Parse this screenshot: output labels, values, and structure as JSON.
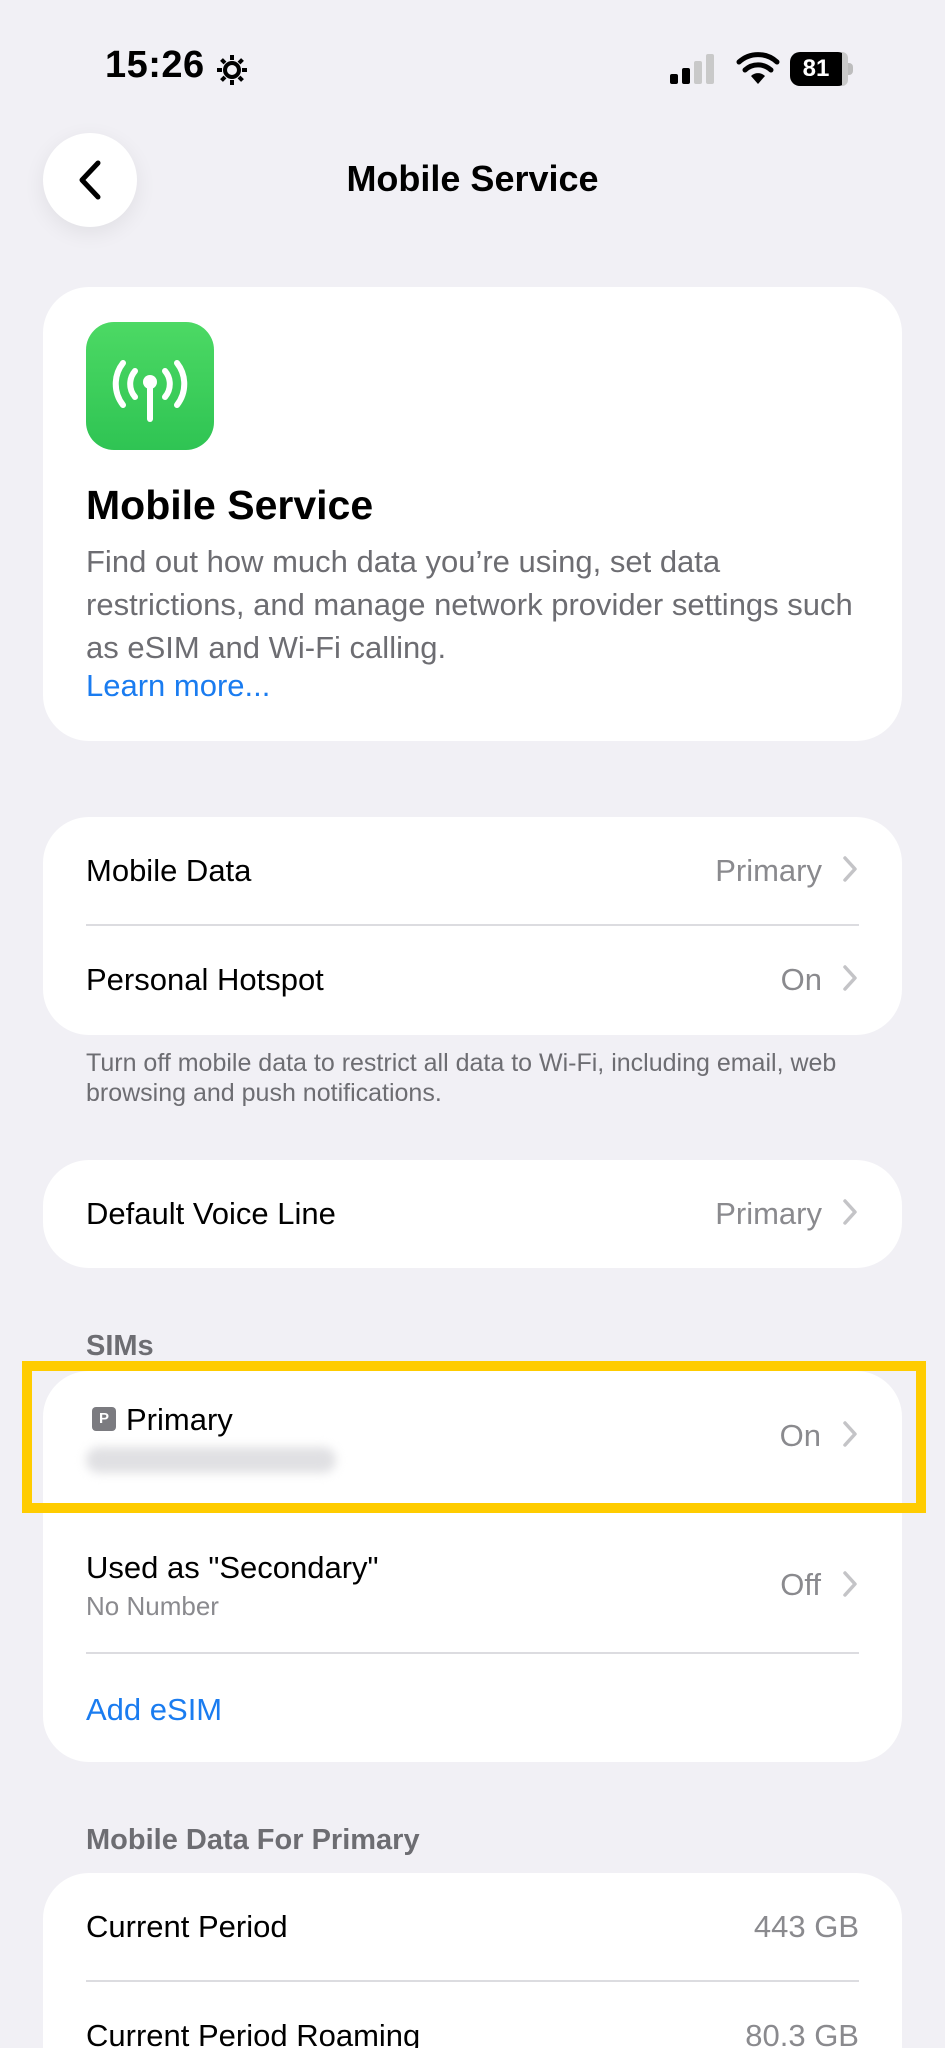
{
  "status_bar": {
    "time": "15:26",
    "battery": "81"
  },
  "nav": {
    "title": "Mobile Service"
  },
  "hero": {
    "title": "Mobile Service",
    "description": "Find out how much data you’re using, set data restrictions, and manage network provider settings such as eSIM and Wi-Fi calling.",
    "learn_more": "Learn more..."
  },
  "data_group": {
    "rows": [
      {
        "label": "Mobile Data",
        "value": "Primary"
      },
      {
        "label": "Personal Hotspot",
        "value": "On"
      }
    ],
    "footer": "Turn off mobile data to restrict all data to Wi-Fi, including email, web browsing and push notifications."
  },
  "voice_group": {
    "label": "Default Voice Line",
    "value": "Primary"
  },
  "sims": {
    "header": "SIMs",
    "badge": "P",
    "primary": {
      "label": "Primary",
      "value": "On"
    },
    "secondary": {
      "label": "Used as \"Secondary\"",
      "sublabel": "No Number",
      "value": "Off"
    },
    "add_esim": "Add eSIM"
  },
  "usage": {
    "header": "Mobile Data For Primary",
    "rows": [
      {
        "label": "Current Period",
        "value": "443 GB"
      },
      {
        "label": "Current Period Roaming",
        "value": "80.3 GB"
      }
    ]
  },
  "colors": {
    "accent": "#1a7cf0",
    "highlight": "#FFCC00",
    "background": "#F1F0F5",
    "app_icon": "#34C759"
  }
}
